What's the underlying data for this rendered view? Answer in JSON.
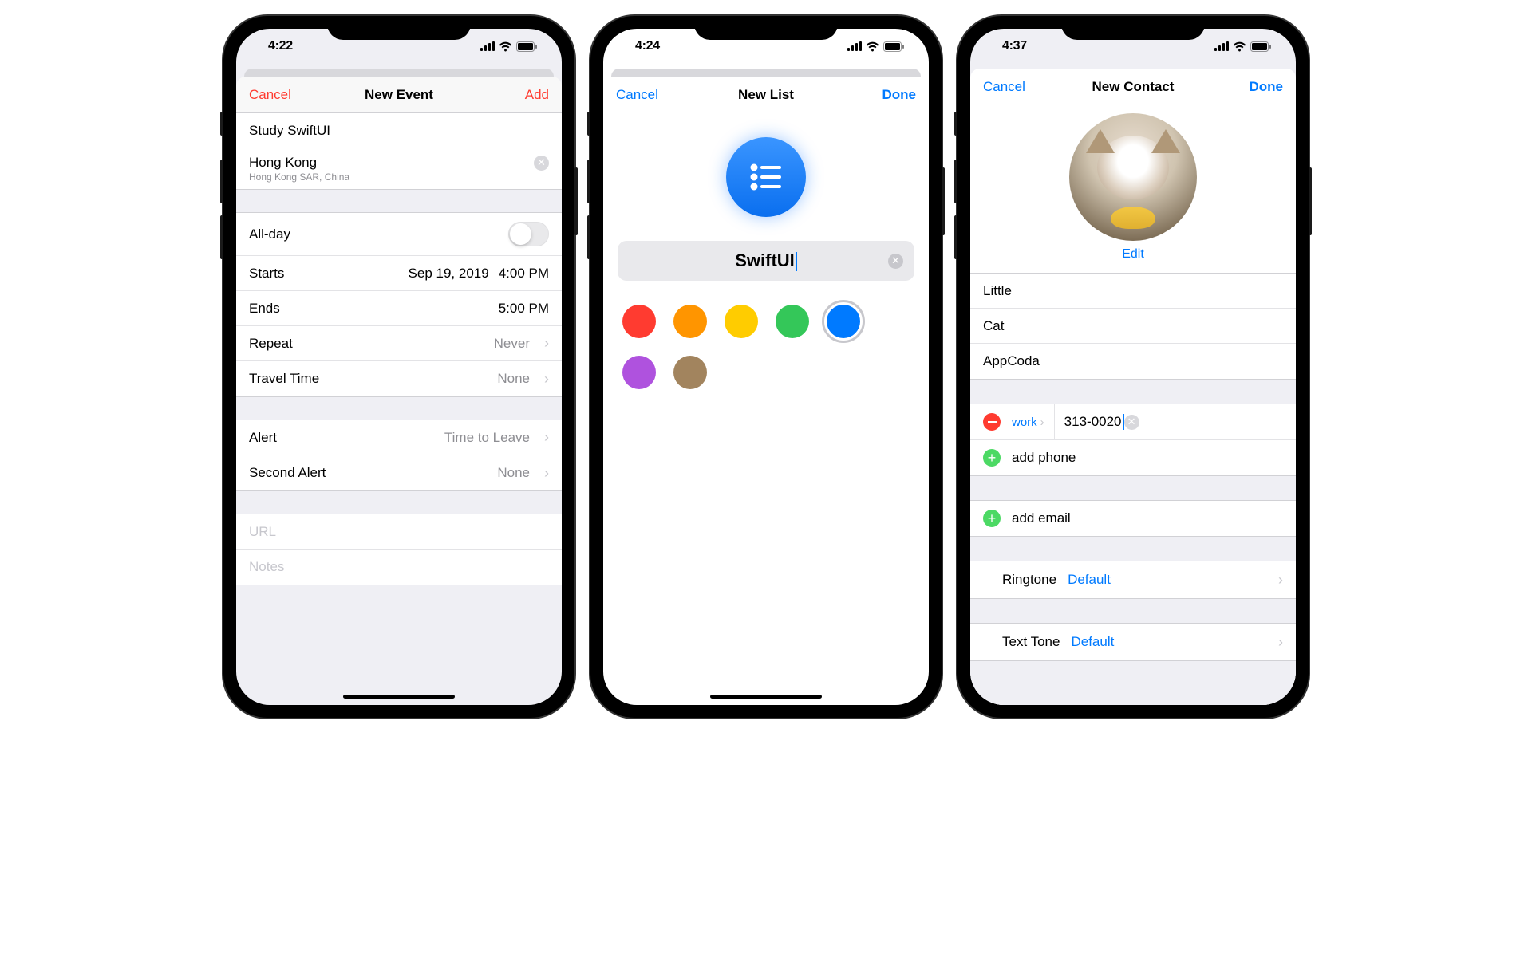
{
  "phone1": {
    "status_time": "4:22",
    "nav": {
      "cancel": "Cancel",
      "title": "New Event",
      "action": "Add"
    },
    "event_title": "Study SwiftUI",
    "location": {
      "name": "Hong Kong",
      "sub": "Hong Kong SAR, China"
    },
    "allday_label": "All-day",
    "starts": {
      "label": "Starts",
      "date": "Sep 19, 2019",
      "time": "4:00 PM"
    },
    "ends": {
      "label": "Ends",
      "time": "5:00 PM"
    },
    "repeat": {
      "label": "Repeat",
      "value": "Never"
    },
    "travel": {
      "label": "Travel Time",
      "value": "None"
    },
    "alert": {
      "label": "Alert",
      "value": "Time to Leave"
    },
    "second_alert": {
      "label": "Second Alert",
      "value": "None"
    },
    "url_placeholder": "URL",
    "notes_placeholder": "Notes"
  },
  "phone2": {
    "status_time": "4:24",
    "nav": {
      "cancel": "Cancel",
      "title": "New List",
      "action": "Done"
    },
    "list_name": "SwiftUI",
    "colors": [
      {
        "name": "red",
        "hex": "#ff3b30"
      },
      {
        "name": "orange",
        "hex": "#ff9500"
      },
      {
        "name": "yellow",
        "hex": "#ffcc00"
      },
      {
        "name": "green",
        "hex": "#34c759"
      },
      {
        "name": "blue",
        "hex": "#007aff",
        "selected": true
      },
      {
        "name": "purple",
        "hex": "#af52de"
      },
      {
        "name": "brown",
        "hex": "#a2845e"
      }
    ]
  },
  "phone3": {
    "status_time": "4:37",
    "nav": {
      "cancel": "Cancel",
      "title": "New Contact",
      "action": "Done"
    },
    "edit_label": "Edit",
    "first_name": "Little",
    "last_name": "Cat",
    "company": "AppCoda",
    "phone": {
      "type": "work",
      "number": "313-0020"
    },
    "add_phone_label": "add phone",
    "add_email_label": "add email",
    "ringtone": {
      "label": "Ringtone",
      "value": "Default"
    },
    "texttone": {
      "label": "Text Tone",
      "value": "Default"
    }
  }
}
